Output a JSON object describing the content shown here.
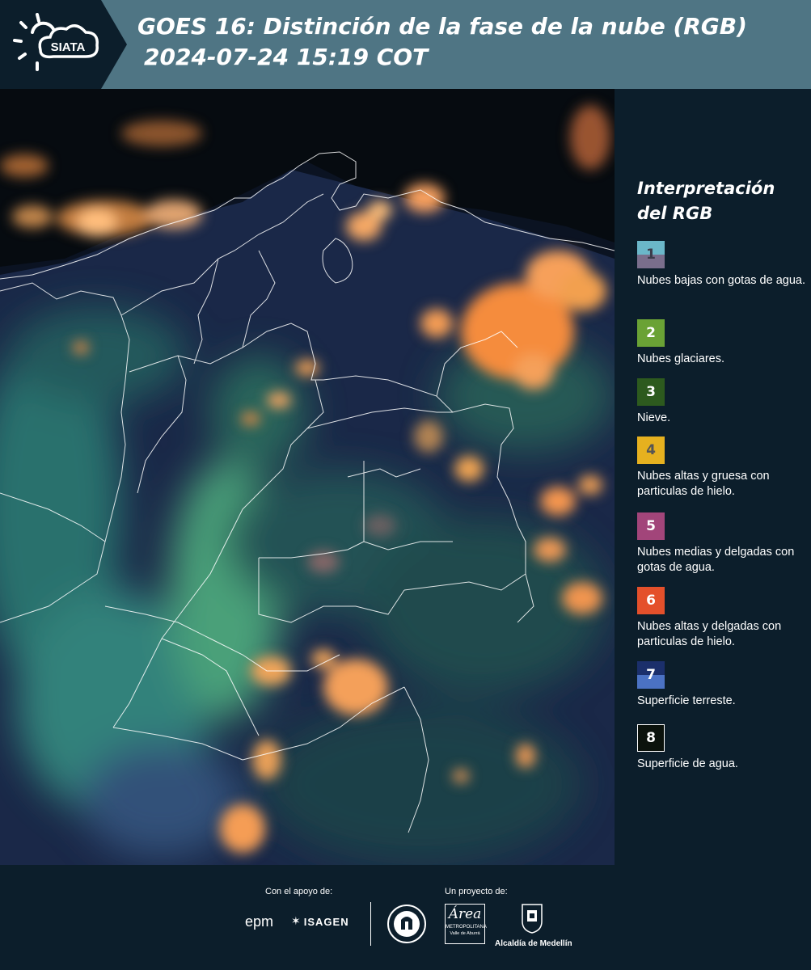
{
  "header": {
    "logo_text": "SIATA",
    "title_line1": "GOES 16: Distinción de la fase de la nube (RGB)",
    "title_line2": "2024-07-24 15:19 COT"
  },
  "legend": {
    "title": "Interpretación del RGB",
    "items": [
      {
        "number": "1",
        "label": "Nubes bajas con gotas de agua.",
        "color_top": "#6bb7c9",
        "color_bottom": "#7a6e8c",
        "text_color": "#3b3b4a"
      },
      {
        "number": "2",
        "label": "Nubes glaciares.",
        "color_top": "#6aa235",
        "color_bottom": "#6aa235",
        "text_color": "#ffffff"
      },
      {
        "number": "3",
        "label": "Nieve.",
        "color_top": "#2d5a1e",
        "color_bottom": "#2d5a1e",
        "text_color": "#ffffff"
      },
      {
        "number": "4",
        "label": "Nubes altas y gruesa con particulas de hielo.",
        "color_top": "#e6b11f",
        "color_bottom": "#e6b11f",
        "text_color": "#555555"
      },
      {
        "number": "5",
        "label": "Nubes medias y delgadas con gotas de agua.",
        "color_top": "#a2457a",
        "color_bottom": "#a2457a",
        "text_color": "#ffffff"
      },
      {
        "number": "6",
        "label": "Nubes altas y delgadas con particulas de hielo.",
        "color_top": "#e4502b",
        "color_bottom": "#e4502b",
        "text_color": "#ffffff"
      },
      {
        "number": "7",
        "label": "Superficie terreste.",
        "color_top": "#1b2f6b",
        "color_bottom": "#4b72c4",
        "text_color": "#ffffff"
      },
      {
        "number": "8",
        "label": "Superficie de agua.",
        "color_top": "#0b120c",
        "color_bottom": "#0b120c",
        "text_color": "#ffffff"
      }
    ]
  },
  "footer": {
    "support_label": "Con el apoyo de:",
    "project_label": "Un proyecto de:",
    "partners": [
      "epm",
      "ISAGEN"
    ],
    "sponsor_line1": "METROPOLITANA",
    "sponsor_line2": "Valle de Aburrá",
    "sponsor_script": "Área",
    "sponsor3": "Alcaldía de Medellín"
  },
  "colors": {
    "background": "#0c1e2b",
    "header": "#4f7584",
    "cloud_high_thick": "#f0a45a",
    "cloud_glacial": "#7fd9b0",
    "land": "#1d2d52"
  }
}
